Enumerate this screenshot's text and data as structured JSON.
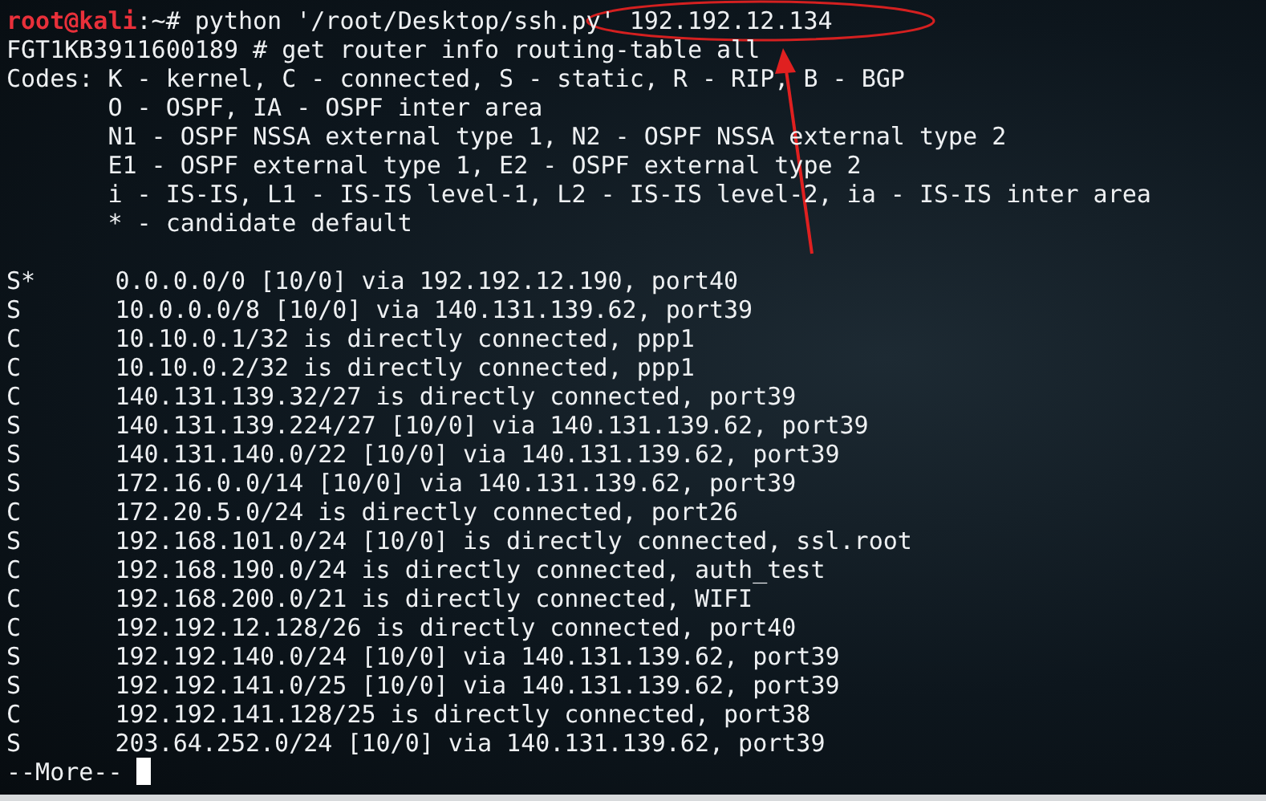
{
  "prompt": {
    "user_host": "root@kali",
    "suffix": ":~# ",
    "command": "python '/root/Desktop/ssh.py' ",
    "argument": "192.192.12.134"
  },
  "header_lines": [
    "FGT1KB3911600189 # get router info routing-table all",
    "Codes: K - kernel, C - connected, S - static, R - RIP, B - BGP",
    "       O - OSPF, IA - OSPF inter area",
    "       N1 - OSPF NSSA external type 1, N2 - OSPF NSSA external type 2",
    "       E1 - OSPF external type 1, E2 - OSPF external type 2",
    "       i - IS-IS, L1 - IS-IS level-1, L2 - IS-IS level-2, ia - IS-IS inter area",
    "       * - candidate default"
  ],
  "routes": [
    {
      "code": "S*",
      "entry": "0.0.0.0/0 [10/0] via 192.192.12.190, port40"
    },
    {
      "code": "S",
      "entry": "10.0.0.0/8 [10/0] via 140.131.139.62, port39"
    },
    {
      "code": "C",
      "entry": "10.10.0.1/32 is directly connected, ppp1"
    },
    {
      "code": "C",
      "entry": "10.10.0.2/32 is directly connected, ppp1"
    },
    {
      "code": "C",
      "entry": "140.131.139.32/27 is directly connected, port39"
    },
    {
      "code": "S",
      "entry": "140.131.139.224/27 [10/0] via 140.131.139.62, port39"
    },
    {
      "code": "S",
      "entry": "140.131.140.0/22 [10/0] via 140.131.139.62, port39"
    },
    {
      "code": "S",
      "entry": "172.16.0.0/14 [10/0] via 140.131.139.62, port39"
    },
    {
      "code": "C",
      "entry": "172.20.5.0/24 is directly connected, port26"
    },
    {
      "code": "S",
      "entry": "192.168.101.0/24 [10/0] is directly connected, ssl.root"
    },
    {
      "code": "C",
      "entry": "192.168.190.0/24 is directly connected, auth_test"
    },
    {
      "code": "C",
      "entry": "192.168.200.0/21 is directly connected, WIFI"
    },
    {
      "code": "C",
      "entry": "192.192.12.128/26 is directly connected, port40"
    },
    {
      "code": "S",
      "entry": "192.192.140.0/24 [10/0] via 140.131.139.62, port39"
    },
    {
      "code": "S",
      "entry": "192.192.141.0/25 [10/0] via 140.131.139.62, port39"
    },
    {
      "code": "C",
      "entry": "192.192.141.128/25 is directly connected, port38"
    },
    {
      "code": "S",
      "entry": "203.64.252.0/24 [10/0] via 140.131.139.62, port39"
    }
  ],
  "pager": "--More-- "
}
